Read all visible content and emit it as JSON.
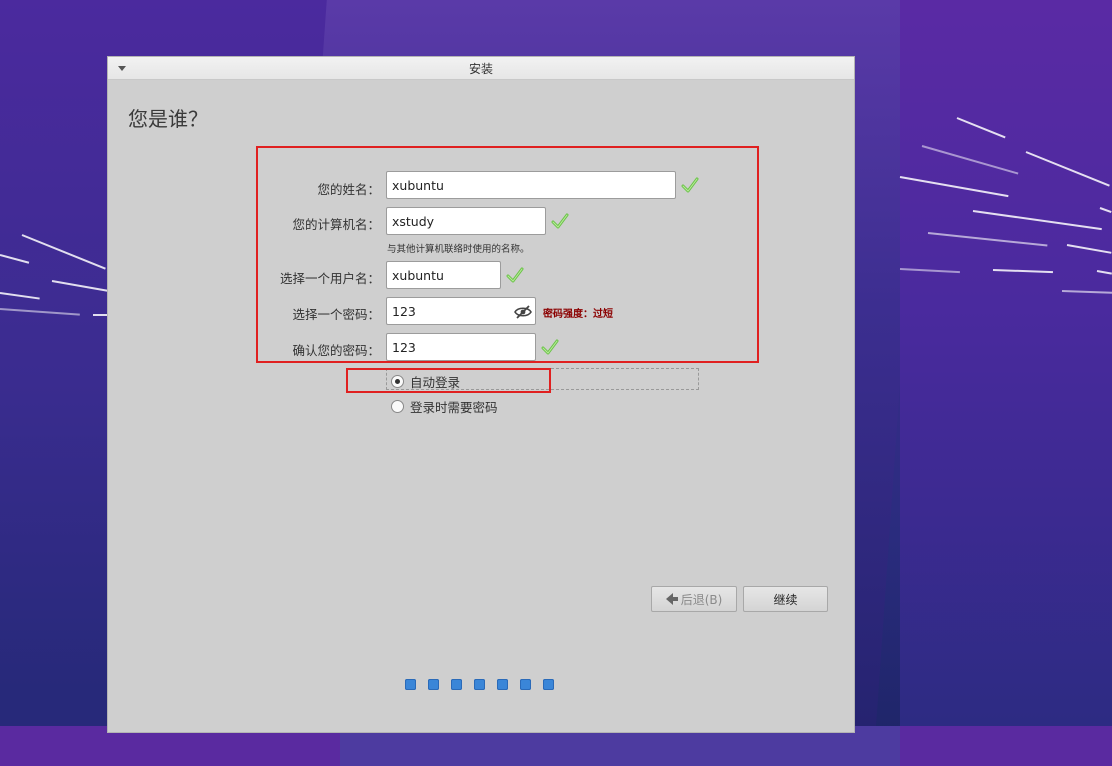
{
  "window": {
    "title": "安装"
  },
  "page": {
    "title": "您是谁？"
  },
  "form": {
    "name_label": "您的姓名：",
    "name_value": "xubuntu",
    "computer_label": "您的计算机名：",
    "computer_value": "xstudy",
    "computer_hint": "与其他计算机联络时使用的名称。",
    "username_label": "选择一个用户名：",
    "username_value": "xubuntu",
    "password_label": "选择一个密码：",
    "password_value": "123",
    "password_strength": "密码强度：过短",
    "confirm_label": "确认您的密码：",
    "confirm_value": "123"
  },
  "login": {
    "auto_login_label": "自动登录",
    "require_password_label": "登录时需要密码",
    "selected": "auto"
  },
  "buttons": {
    "back_label": "后退(B)",
    "continue_label": "继续"
  },
  "progress": {
    "total_steps": 7
  },
  "colors": {
    "check": "#6cc24a",
    "annotation": "#e02020",
    "step_dot": "#3a86d8",
    "strength_text": "#8b0000"
  },
  "icons": {
    "valid": "check-icon",
    "reveal_password": "eye-slash-icon",
    "back": "back-arrow-icon",
    "window_menu": "chevron-down-icon"
  }
}
